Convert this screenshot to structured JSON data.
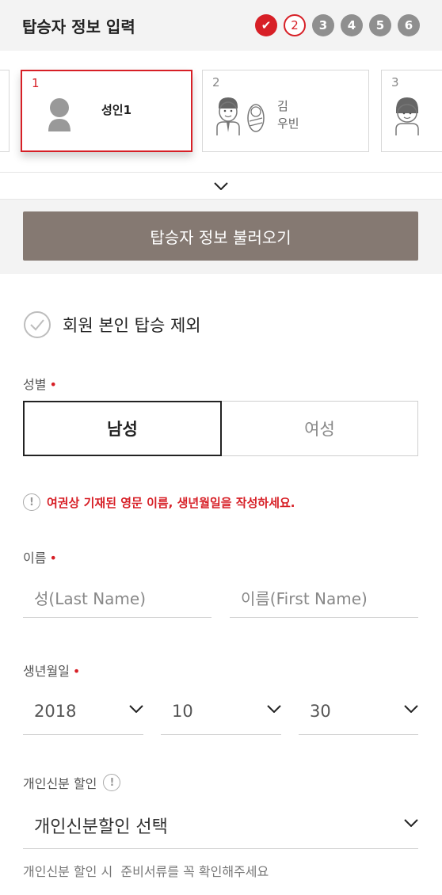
{
  "header": {
    "title": "탑승자 정보 입력",
    "steps": [
      "✔",
      "2",
      "3",
      "4",
      "5",
      "6"
    ]
  },
  "passengers": [
    {
      "number": "1",
      "name": "성인1"
    },
    {
      "number": "2",
      "name_line1": "김",
      "name_line2": "우빈"
    },
    {
      "number": "3"
    }
  ],
  "load_button": "탑승자 정보 불러오기",
  "exclude_member": "회원 본인 탑승 제외",
  "gender": {
    "label": "성별",
    "required_mark": "•",
    "options": [
      "남성",
      "여성"
    ],
    "selected": "남성"
  },
  "notice": "여권상 기재된 영문 이름, 생년월일을 작성하세요.",
  "name": {
    "label": "이름",
    "required_mark": "•",
    "last_placeholder": "성(Last Name)",
    "first_placeholder": "이름(First Name)"
  },
  "birth": {
    "label": "생년월일",
    "required_mark": "•",
    "year": "2018",
    "month": "10",
    "day": "30"
  },
  "discount": {
    "label": "개인신분 할인",
    "select_value": "개인신분할인 선택",
    "hint": "개인신분 할인 시  준비서류를 꼭 확인해주세요"
  },
  "colors": {
    "accent": "#d71f26",
    "button": "#857972",
    "band": "#f3f3f3"
  }
}
